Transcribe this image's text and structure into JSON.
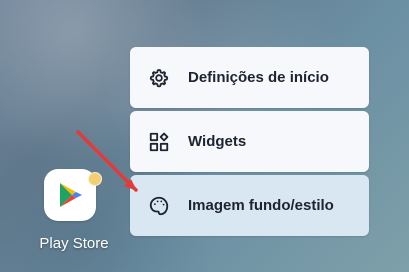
{
  "menu": {
    "items": [
      {
        "label": "Definições de início",
        "icon": "settings-gear-icon"
      },
      {
        "label": "Widgets",
        "icon": "widgets-icon"
      },
      {
        "label": "Imagem fundo/estilo",
        "icon": "palette-icon"
      }
    ]
  },
  "app": {
    "label": "Play Store",
    "icon": "play-store-icon",
    "badge": "notification-dot",
    "badge_color": "#F2CF74"
  },
  "overlay": {
    "annotation": "red-arrow",
    "arrow_color": "#E33A3A"
  }
}
